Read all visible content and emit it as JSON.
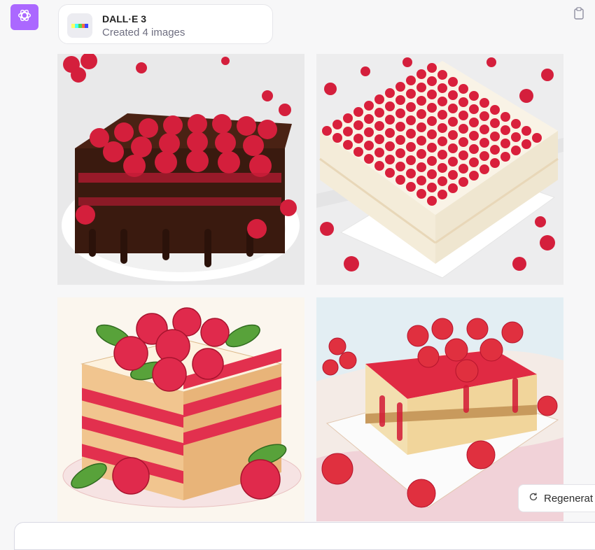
{
  "assistant": {
    "avatar_icon": "openai-logo-icon",
    "avatar_color": "#ab68ff"
  },
  "tool_card": {
    "title": "DALL·E 3",
    "subtitle": "Created 4 images",
    "logo_icon": "dalle-logo-icon"
  },
  "actions": {
    "copy_icon": "clipboard-icon",
    "regenerate_label": "Regenerat",
    "regenerate_icon": "refresh-icon"
  },
  "images": [
    {
      "subject": "chocolate raspberry layer cake",
      "style": "photo"
    },
    {
      "subject": "raspberry cream square cake",
      "style": "photo"
    },
    {
      "subject": "raspberry layer cake with mint",
      "style": "illustration"
    },
    {
      "subject": "raspberry cheesecake slice",
      "style": "watercolor"
    }
  ]
}
